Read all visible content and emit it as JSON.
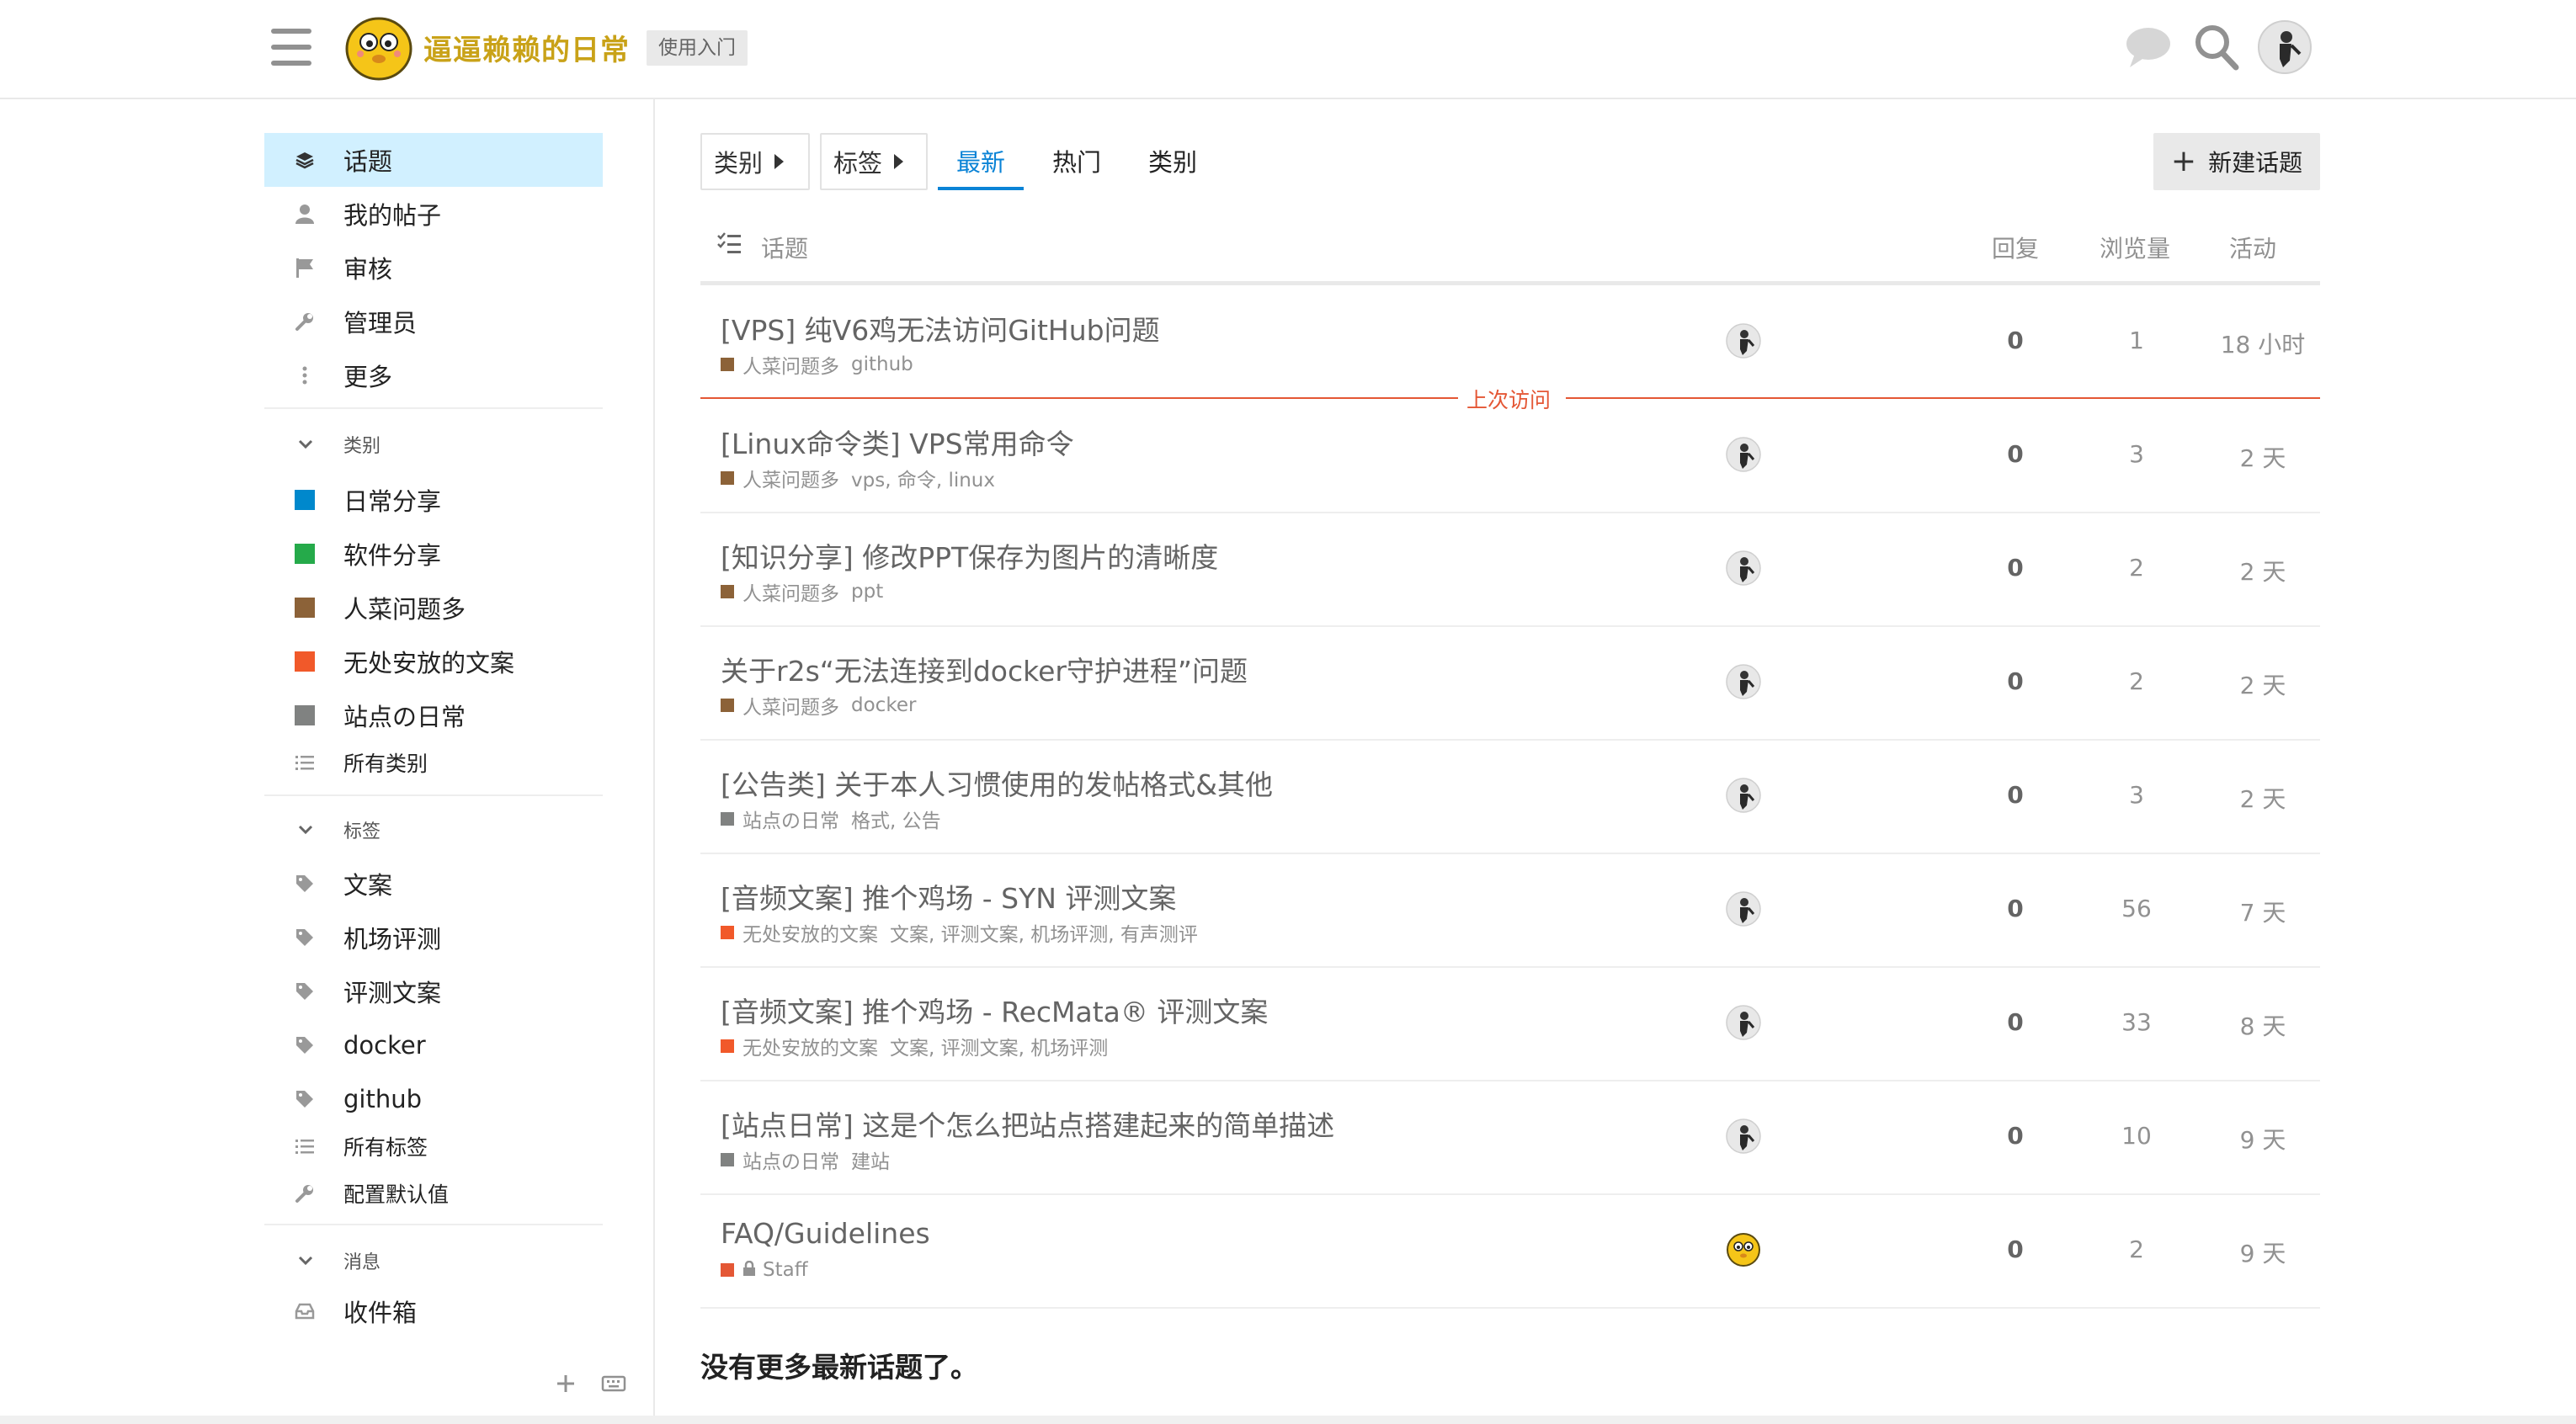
{
  "header": {
    "site_title": "逼逼赖赖的日常",
    "guide_tag": "使用入门"
  },
  "sidebar": {
    "main_items": [
      {
        "label": "话题",
        "icon": "layers-icon"
      },
      {
        "label": "我的帖子",
        "icon": "user-icon"
      },
      {
        "label": "审核",
        "icon": "flag-icon"
      },
      {
        "label": "管理员",
        "icon": "wrench-icon"
      },
      {
        "label": "更多",
        "icon": "vertical-dots-icon"
      }
    ],
    "categories_header": "类别",
    "categories": [
      {
        "label": "日常分享",
        "color": "#0088cc"
      },
      {
        "label": "软件分享",
        "color": "#25aa4a"
      },
      {
        "label": "人菜问题多",
        "color": "#8c6238"
      },
      {
        "label": "无处安放的文案",
        "color": "#f1592a"
      },
      {
        "label": "站点の日常",
        "color": "#808281"
      }
    ],
    "all_categories": "所有类别",
    "tags_header": "标签",
    "tags": [
      "文案",
      "机场评测",
      "评测文案",
      "docker",
      "github"
    ],
    "all_tags": "所有标签",
    "configure_defaults": "配置默认值",
    "messages_header": "消息",
    "inbox": "收件箱"
  },
  "nav": {
    "categories_dropdown": "类别",
    "tags_dropdown": "标签",
    "tabs": [
      "最新",
      "热门",
      "类别"
    ],
    "active_tab": "最新",
    "new_topic": "新建话题"
  },
  "columns": {
    "topic": "话题",
    "replies": "回复",
    "views": "浏览量",
    "activity": "活动"
  },
  "last_visit_label": "上次访问",
  "topics": [
    {
      "title": "[VPS] 纯V6鸡无法访问GitHub问题",
      "category": "人菜问题多",
      "category_color": "#8c6238",
      "tags": "github",
      "replies": "0",
      "views": "1",
      "activity": "18 小时"
    },
    {
      "title": "[Linux命令类] VPS常用命令",
      "category": "人菜问题多",
      "category_color": "#8c6238",
      "tags": "vps, 命令, linux",
      "replies": "0",
      "views": "3",
      "activity": "2 天"
    },
    {
      "title": "[知识分享] 修改PPT保存为图片的清晰度",
      "category": "人菜问题多",
      "category_color": "#8c6238",
      "tags": "ppt",
      "replies": "0",
      "views": "2",
      "activity": "2 天"
    },
    {
      "title": "关于r2s“无法连接到docker守护进程”问题",
      "category": "人菜问题多",
      "category_color": "#8c6238",
      "tags": "docker",
      "replies": "0",
      "views": "2",
      "activity": "2 天"
    },
    {
      "title": "[公告类] 关于本人习惯使用的发帖格式&其他",
      "category": "站点の日常",
      "category_color": "#808281",
      "tags": "格式, 公告",
      "replies": "0",
      "views": "3",
      "activity": "2 天"
    },
    {
      "title": "[音频文案] 推个鸡场 - SYN 评测文案",
      "category": "无处安放的文案",
      "category_color": "#f1592a",
      "tags": "文案, 评测文案, 机场评测, 有声测评",
      "replies": "0",
      "views": "56",
      "activity": "7 天"
    },
    {
      "title": "[音频文案] 推个鸡场 - RecMata® 评测文案",
      "category": "无处安放的文案",
      "category_color": "#f1592a",
      "tags": "文案, 评测文案, 机场评测",
      "replies": "0",
      "views": "33",
      "activity": "8 天"
    },
    {
      "title": "[站点日常] 这是个怎么把站点搭建起来的简单描述",
      "category": "站点の日常",
      "category_color": "#808281",
      "tags": "建站",
      "replies": "0",
      "views": "10",
      "activity": "9 天"
    },
    {
      "title": "FAQ/Guidelines",
      "category": "Staff",
      "category_color": "#e45735",
      "tags": "",
      "replies": "0",
      "views": "2",
      "activity": "9 天"
    }
  ],
  "footer_message": "没有更多最新话题了。",
  "colors": {
    "accent": "#0a83d6",
    "active_sidebar_bg": "#d1f0ff",
    "last_visit_line": "#e45735",
    "logo_yellow": "#f5c518"
  }
}
